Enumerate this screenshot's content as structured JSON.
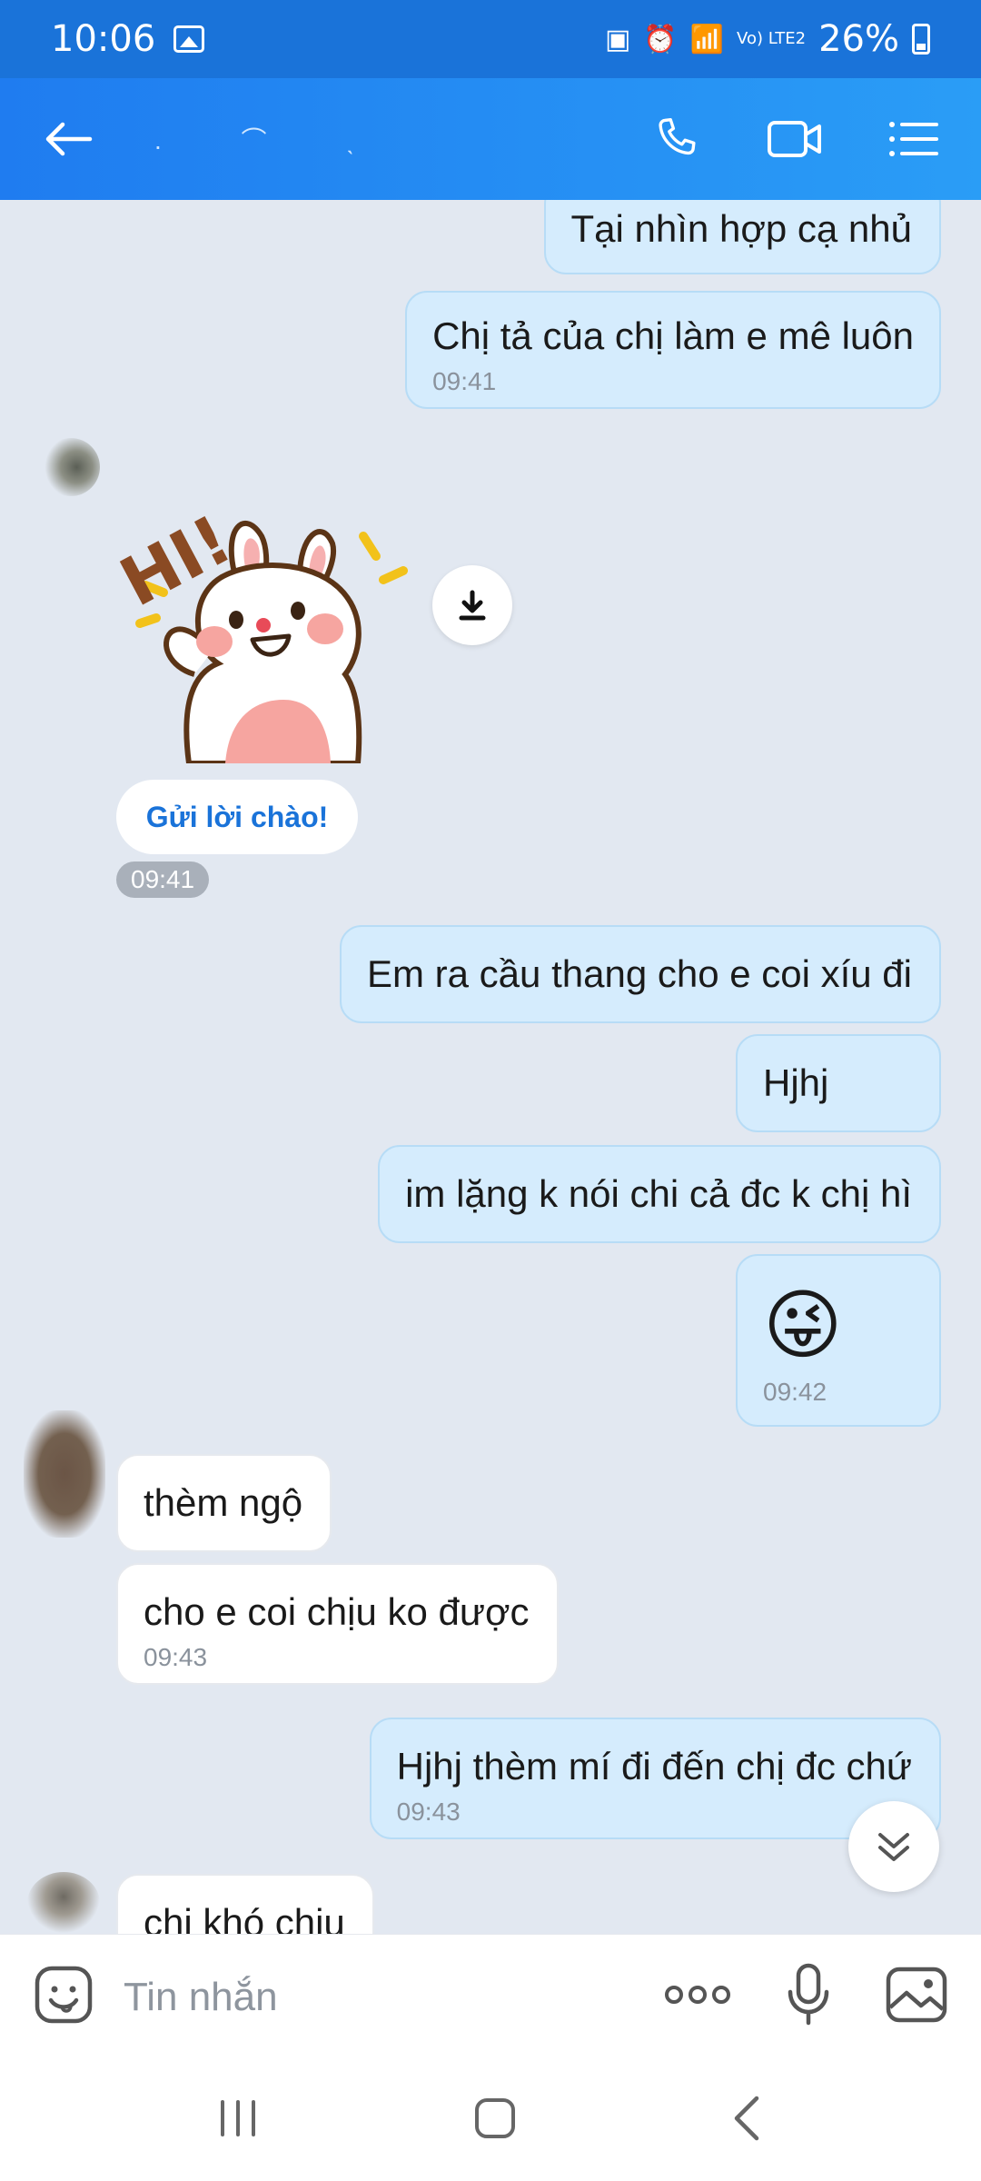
{
  "status_bar": {
    "time": "10:06",
    "battery": "26%",
    "network": "Vo) LTE2"
  },
  "header": {
    "back_icon": "arrow-left-icon",
    "contact_name": ". ⌒ ˎ",
    "call_icon": "phone-icon",
    "video_icon": "video-camera-icon",
    "menu_icon": "list-menu-icon"
  },
  "messages": [
    {
      "text": "Tại nhìn hợp cạ nhủ"
    },
    {
      "text": "Chị tả của chị làm e mê luôn",
      "time": "09:41"
    },
    {
      "text": "Em ra cầu thang cho e coi xíu đi"
    },
    {
      "text": "Hjhj"
    },
    {
      "text": "im lặng k nói chi cả đc k chị hì"
    },
    {
      "text": "😜",
      "time": "09:42"
    },
    {
      "text": "thèm ngộ"
    },
    {
      "text": "cho e coi chịu ko được",
      "time": "09:43"
    },
    {
      "text": "Hjhj thèm mí đi đến chị đc chứ",
      "time": "09:43"
    },
    {
      "text": "chị khó chịu"
    }
  ],
  "sticker": {
    "text": "HI!",
    "greet_button": "Gửi lời chào!",
    "time": "09:41"
  },
  "input": {
    "placeholder": "Tin nhắn",
    "more_label": "ooo"
  },
  "colors": {
    "header": "#1f7cf0",
    "sent_bubble": "#d5ecfd",
    "received_bubble": "#ffffff",
    "background": "#e2e8f1",
    "accent": "#1a73d9"
  }
}
